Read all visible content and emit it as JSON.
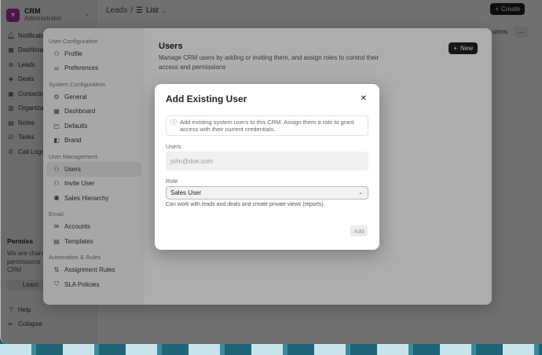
{
  "app": {
    "name": "CRM",
    "role": "Administrator"
  },
  "sidebar": {
    "items": [
      {
        "label": "Notifications",
        "icon": "bell-icon"
      },
      {
        "label": "Dashboard",
        "icon": "dashboard-icon"
      },
      {
        "label": "Leads",
        "icon": "leads-icon"
      },
      {
        "label": "Deals",
        "icon": "deals-icon"
      },
      {
        "label": "Contacts",
        "icon": "contacts-icon"
      },
      {
        "label": "Organizations",
        "icon": "building-icon"
      },
      {
        "label": "Notes",
        "icon": "notes-icon"
      },
      {
        "label": "Tasks",
        "icon": "tasks-icon"
      },
      {
        "label": "Call Logs",
        "icon": "phone-icon"
      }
    ],
    "permission_title": "Permiss",
    "permission_text": [
      "We are chang",
      "permissions",
      "CRM"
    ],
    "learn_label": "Learn",
    "help_label": "Help",
    "collapse_label": "Collapse"
  },
  "header": {
    "breadcrumb_leads": "Leads",
    "breadcrumb_sep": "/",
    "breadcrumb_view": "List",
    "create_label": "Create",
    "columns_label": "umns"
  },
  "settings": {
    "groups": [
      {
        "title": "User Configuration",
        "items": [
          {
            "label": "Profile",
            "icon": "user-icon"
          },
          {
            "label": "Preferences",
            "icon": "sliders-icon"
          }
        ]
      },
      {
        "title": "System Configuration",
        "items": [
          {
            "label": "General",
            "icon": "gear-icon"
          },
          {
            "label": "Dashboard",
            "icon": "dashboard-icon"
          },
          {
            "label": "Defaults",
            "icon": "defaults-icon"
          },
          {
            "label": "Brand",
            "icon": "brand-icon"
          }
        ]
      },
      {
        "title": "User Management",
        "items": [
          {
            "label": "Users",
            "icon": "user-icon",
            "active": true
          },
          {
            "label": "Invite User",
            "icon": "user-plus-icon"
          },
          {
            "label": "Sales Hierarchy",
            "icon": "hierarchy-icon"
          }
        ]
      },
      {
        "title": "Email",
        "items": [
          {
            "label": "Accounts",
            "icon": "mail-icon"
          },
          {
            "label": "Templates",
            "icon": "template-icon"
          }
        ]
      },
      {
        "title": "Automation & Rules",
        "items": [
          {
            "label": "Assignment Rules",
            "icon": "rules-icon"
          },
          {
            "label": "SLA Policies",
            "icon": "shield-icon"
          }
        ]
      }
    ],
    "users_title": "Users",
    "users_desc": "Manage CRM users by adding or inviting them, and assign roles to control their access and permissions",
    "new_label": "New"
  },
  "dialog": {
    "title": "Add Existing User",
    "info": "Add existing system users to this CRM. Assign them a role to grant access with their current credentials.",
    "users_label": "Users",
    "users_placeholder": "john@doe.com",
    "role_label": "Role",
    "role_value": "Sales User",
    "role_hint": "Can work with leads and deals and create private views (reports).",
    "add_label": "Add"
  }
}
